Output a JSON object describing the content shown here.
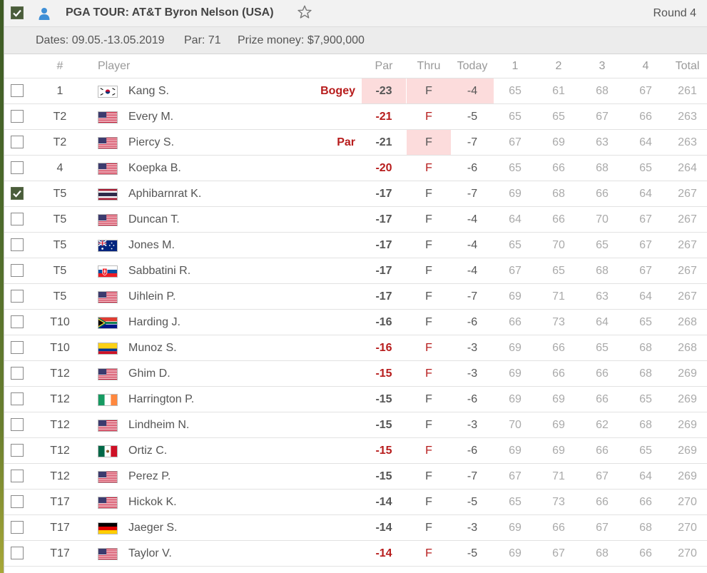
{
  "header": {
    "title": "PGA TOUR: AT&T Byron Nelson (USA)",
    "round": "Round 4",
    "icons": [
      "checkbox-checked-icon",
      "person-icon",
      "star-outline-icon"
    ]
  },
  "info": {
    "dates": "Dates: 09.05.-13.05.2019",
    "par": "Par: 71",
    "prize": "Prize money: $7,900,000"
  },
  "columns": {
    "pos": "#",
    "player": "Player",
    "par": "Par",
    "thru": "Thru",
    "today": "Today",
    "r1": "1",
    "r2": "2",
    "r3": "3",
    "r4": "4",
    "total": "Total"
  },
  "colors": {
    "accent_red": "#b71c1c",
    "highlight": "#fcdcdc",
    "checkbox_green": "#4a5d3b"
  },
  "rows": [
    {
      "checked": false,
      "pos": "1",
      "flag": "KR",
      "name": "Kang S.",
      "event": "Bogey",
      "par": "-23",
      "par_red": false,
      "thru": "F",
      "thru_red": false,
      "today": "-4",
      "r1": "65",
      "r2": "61",
      "r3": "68",
      "r4": "67",
      "total": "261",
      "hl": [
        "par",
        "thru",
        "today"
      ]
    },
    {
      "checked": false,
      "pos": "T2",
      "flag": "US",
      "name": "Every M.",
      "event": "",
      "par": "-21",
      "par_red": true,
      "thru": "F",
      "thru_red": true,
      "today": "-5",
      "r1": "65",
      "r2": "65",
      "r3": "67",
      "r4": "66",
      "total": "263",
      "hl": []
    },
    {
      "checked": false,
      "pos": "T2",
      "flag": "US",
      "name": "Piercy S.",
      "event": "Par",
      "par": "-21",
      "par_red": false,
      "thru": "F",
      "thru_red": false,
      "today": "-7",
      "r1": "67",
      "r2": "69",
      "r3": "63",
      "r4": "64",
      "total": "263",
      "hl": [
        "thru"
      ]
    },
    {
      "checked": false,
      "pos": "4",
      "flag": "US",
      "name": "Koepka B.",
      "event": "",
      "par": "-20",
      "par_red": true,
      "thru": "F",
      "thru_red": true,
      "today": "-6",
      "r1": "65",
      "r2": "66",
      "r3": "68",
      "r4": "65",
      "total": "264",
      "hl": []
    },
    {
      "checked": true,
      "pos": "T5",
      "flag": "TH",
      "name": "Aphibarnrat K.",
      "event": "",
      "par": "-17",
      "par_red": false,
      "thru": "F",
      "thru_red": false,
      "today": "-7",
      "r1": "69",
      "r2": "68",
      "r3": "66",
      "r4": "64",
      "total": "267",
      "hl": []
    },
    {
      "checked": false,
      "pos": "T5",
      "flag": "US",
      "name": "Duncan T.",
      "event": "",
      "par": "-17",
      "par_red": false,
      "thru": "F",
      "thru_red": false,
      "today": "-4",
      "r1": "64",
      "r2": "66",
      "r3": "70",
      "r4": "67",
      "total": "267",
      "hl": []
    },
    {
      "checked": false,
      "pos": "T5",
      "flag": "AU",
      "name": "Jones M.",
      "event": "",
      "par": "-17",
      "par_red": false,
      "thru": "F",
      "thru_red": false,
      "today": "-4",
      "r1": "65",
      "r2": "70",
      "r3": "65",
      "r4": "67",
      "total": "267",
      "hl": []
    },
    {
      "checked": false,
      "pos": "T5",
      "flag": "SK",
      "name": "Sabbatini R.",
      "event": "",
      "par": "-17",
      "par_red": false,
      "thru": "F",
      "thru_red": false,
      "today": "-4",
      "r1": "67",
      "r2": "65",
      "r3": "68",
      "r4": "67",
      "total": "267",
      "hl": []
    },
    {
      "checked": false,
      "pos": "T5",
      "flag": "US",
      "name": "Uihlein P.",
      "event": "",
      "par": "-17",
      "par_red": false,
      "thru": "F",
      "thru_red": false,
      "today": "-7",
      "r1": "69",
      "r2": "71",
      "r3": "63",
      "r4": "64",
      "total": "267",
      "hl": []
    },
    {
      "checked": false,
      "pos": "T10",
      "flag": "ZA",
      "name": "Harding J.",
      "event": "",
      "par": "-16",
      "par_red": false,
      "thru": "F",
      "thru_red": false,
      "today": "-6",
      "r1": "66",
      "r2": "73",
      "r3": "64",
      "r4": "65",
      "total": "268",
      "hl": []
    },
    {
      "checked": false,
      "pos": "T10",
      "flag": "CO",
      "name": "Munoz S.",
      "event": "",
      "par": "-16",
      "par_red": true,
      "thru": "F",
      "thru_red": true,
      "today": "-3",
      "r1": "69",
      "r2": "66",
      "r3": "65",
      "r4": "68",
      "total": "268",
      "hl": []
    },
    {
      "checked": false,
      "pos": "T12",
      "flag": "US",
      "name": "Ghim D.",
      "event": "",
      "par": "-15",
      "par_red": true,
      "thru": "F",
      "thru_red": true,
      "today": "-3",
      "r1": "69",
      "r2": "66",
      "r3": "66",
      "r4": "68",
      "total": "269",
      "hl": []
    },
    {
      "checked": false,
      "pos": "T12",
      "flag": "IE",
      "name": "Harrington P.",
      "event": "",
      "par": "-15",
      "par_red": false,
      "thru": "F",
      "thru_red": false,
      "today": "-6",
      "r1": "69",
      "r2": "69",
      "r3": "66",
      "r4": "65",
      "total": "269",
      "hl": []
    },
    {
      "checked": false,
      "pos": "T12",
      "flag": "US",
      "name": "Lindheim N.",
      "event": "",
      "par": "-15",
      "par_red": false,
      "thru": "F",
      "thru_red": false,
      "today": "-3",
      "r1": "70",
      "r2": "69",
      "r3": "62",
      "r4": "68",
      "total": "269",
      "hl": []
    },
    {
      "checked": false,
      "pos": "T12",
      "flag": "MX",
      "name": "Ortiz C.",
      "event": "",
      "par": "-15",
      "par_red": true,
      "thru": "F",
      "thru_red": true,
      "today": "-6",
      "r1": "69",
      "r2": "69",
      "r3": "66",
      "r4": "65",
      "total": "269",
      "hl": []
    },
    {
      "checked": false,
      "pos": "T12",
      "flag": "US",
      "name": "Perez P.",
      "event": "",
      "par": "-15",
      "par_red": false,
      "thru": "F",
      "thru_red": false,
      "today": "-7",
      "r1": "67",
      "r2": "71",
      "r3": "67",
      "r4": "64",
      "total": "269",
      "hl": []
    },
    {
      "checked": false,
      "pos": "T17",
      "flag": "US",
      "name": "Hickok K.",
      "event": "",
      "par": "-14",
      "par_red": false,
      "thru": "F",
      "thru_red": false,
      "today": "-5",
      "r1": "65",
      "r2": "73",
      "r3": "66",
      "r4": "66",
      "total": "270",
      "hl": []
    },
    {
      "checked": false,
      "pos": "T17",
      "flag": "DE",
      "name": "Jaeger S.",
      "event": "",
      "par": "-14",
      "par_red": false,
      "thru": "F",
      "thru_red": false,
      "today": "-3",
      "r1": "69",
      "r2": "66",
      "r3": "67",
      "r4": "68",
      "total": "270",
      "hl": []
    },
    {
      "checked": false,
      "pos": "T17",
      "flag": "US",
      "name": "Taylor V.",
      "event": "",
      "par": "-14",
      "par_red": true,
      "thru": "F",
      "thru_red": true,
      "today": "-5",
      "r1": "69",
      "r2": "67",
      "r3": "68",
      "r4": "66",
      "total": "270",
      "hl": []
    }
  ]
}
